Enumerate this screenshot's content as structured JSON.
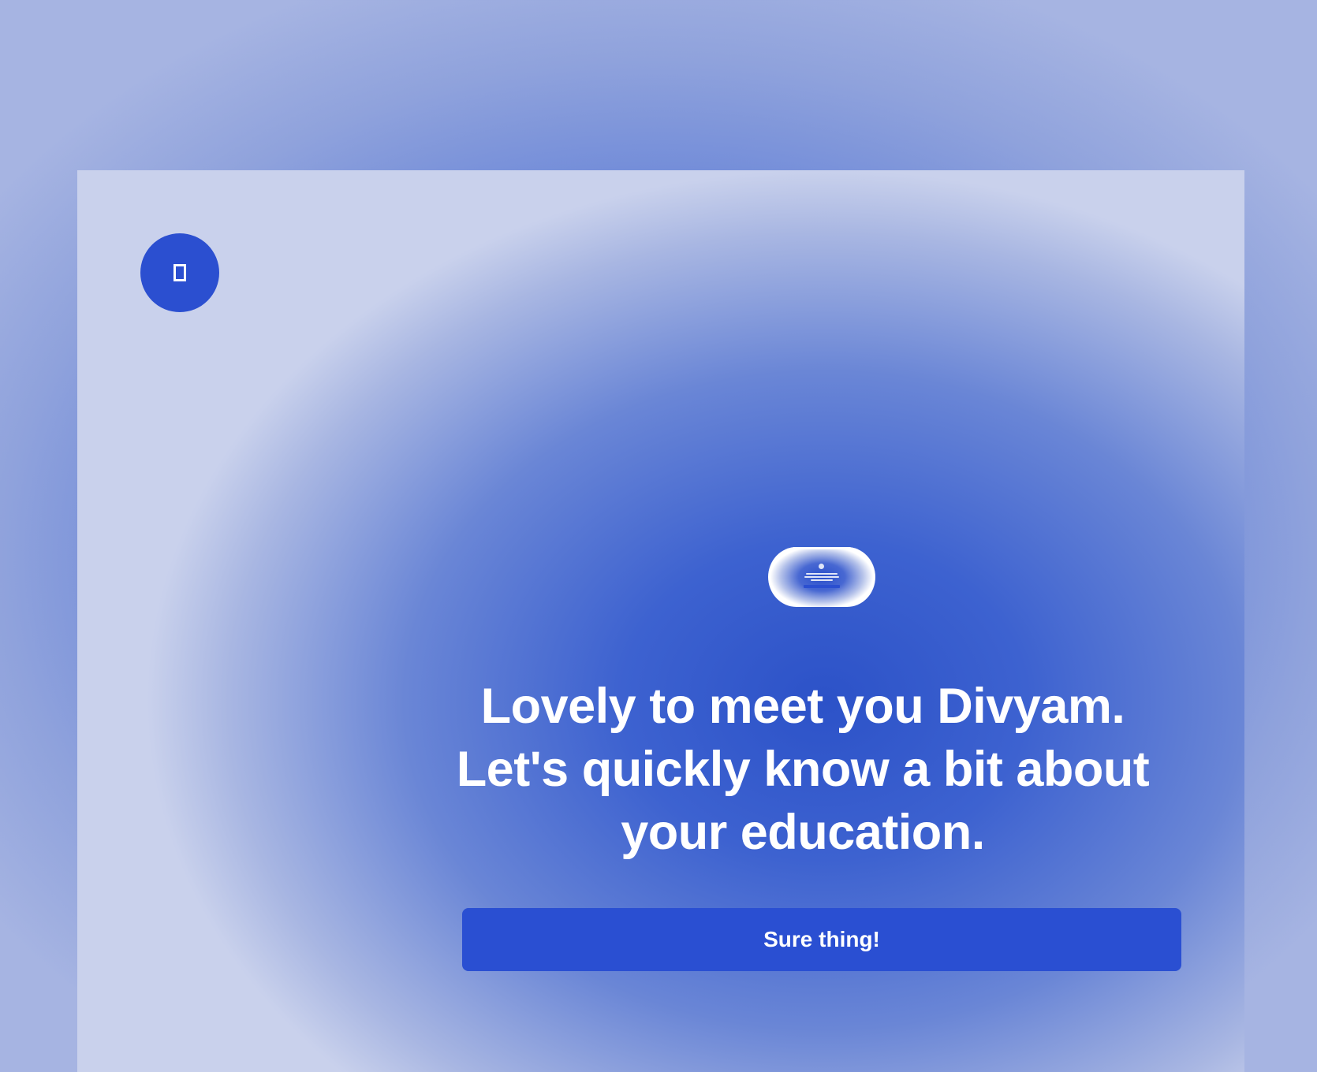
{
  "logo": {
    "icon": "brand-logo-icon"
  },
  "preview": {
    "icon": "screen-preview-thumbnail"
  },
  "headline": {
    "line1": "Lovely to meet you Divyam.",
    "line2": "Let's quickly know a bit about",
    "line3": "your education."
  },
  "cta": {
    "label": "Sure thing!"
  },
  "colors": {
    "accent": "#2B4FD0",
    "text": "#FFFFFF",
    "background": "#5A7AD6"
  }
}
